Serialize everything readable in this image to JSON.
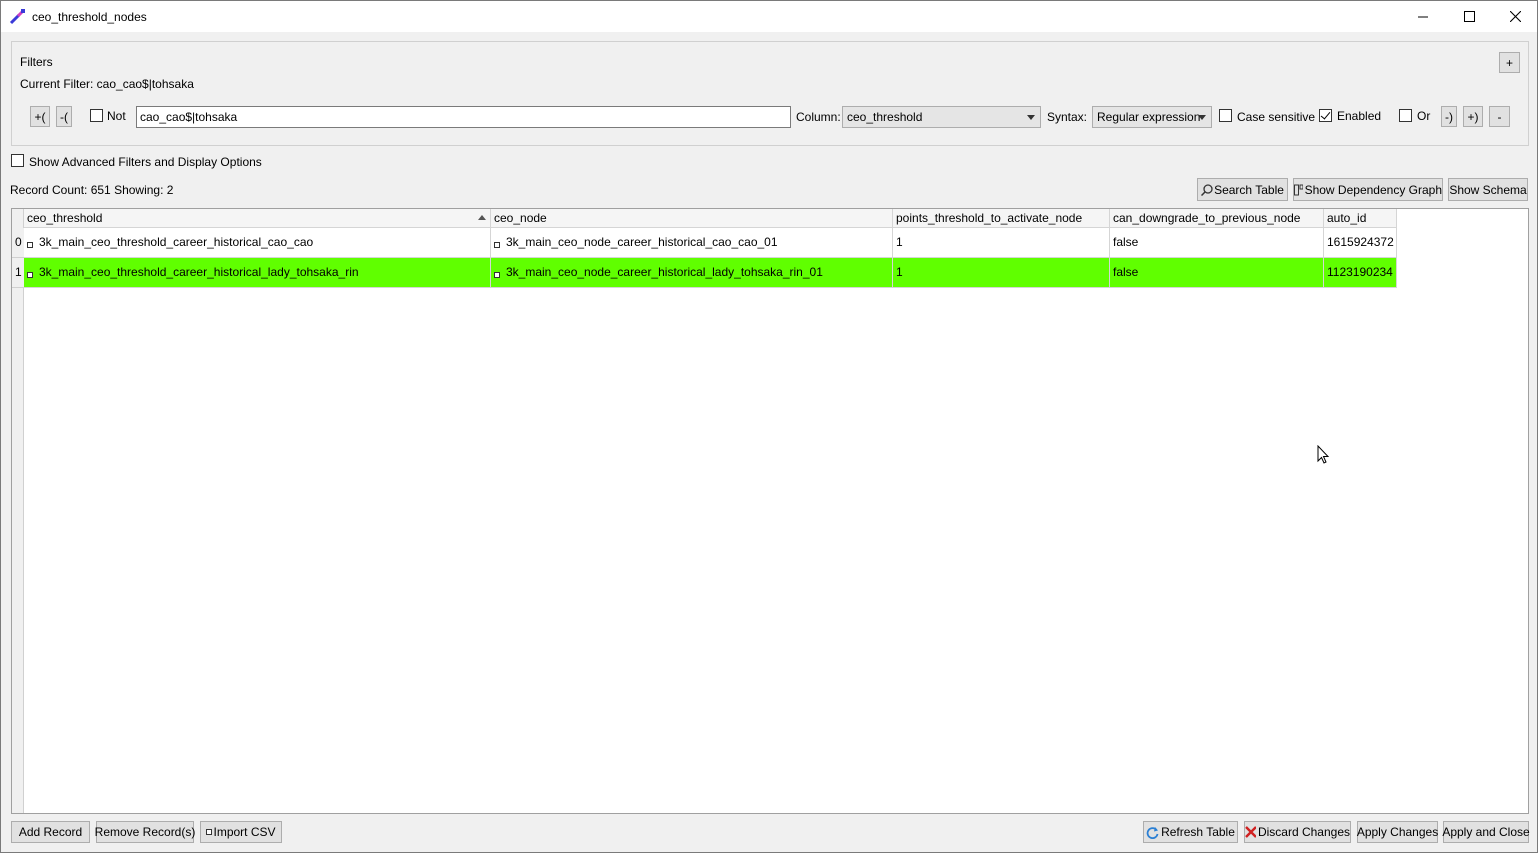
{
  "window": {
    "title": "ceo_threshold_nodes",
    "accent_icon_colors": [
      "#3a3ad8",
      "#d040c0"
    ]
  },
  "filters": {
    "group_label": "Filters",
    "add_label": "+",
    "current_filter_text": "Current Filter: cao_cao$|tohsaka",
    "open_paren_label": "+(",
    "remove_paren_label": "-(",
    "not_label": "Not",
    "not_checked": false,
    "filter_value": "cao_cao$|tohsaka",
    "column_label": "Column:",
    "column_value": "ceo_threshold",
    "syntax_label": "Syntax:",
    "syntax_value": "Regular expression",
    "case_sensitive_label": "Case sensitive",
    "case_sensitive_checked": false,
    "enabled_label": "Enabled",
    "enabled_checked": true,
    "or_label": "Or",
    "or_checked": false,
    "close_paren_minus_label": "-)",
    "close_paren_plus_label": "+)",
    "remove_label": "-"
  },
  "advanced": {
    "label": "Show Advanced Filters and Display Options",
    "checked": false
  },
  "status": {
    "record_count_text": "Record Count:  651  Showing:  2"
  },
  "toolbar": {
    "search_table": "Search Table",
    "show_dependency_graph": "Show Dependency Graph",
    "show_schema": "Show Schema"
  },
  "table": {
    "columns": [
      "ceo_threshold",
      "ceo_node",
      "points_threshold_to_activate_node",
      "can_downgrade_to_previous_node",
      "auto_id"
    ],
    "sorted_column": "ceo_threshold",
    "rows": [
      {
        "index": "0",
        "ceo_threshold": "3k_main_ceo_threshold_career_historical_cao_cao",
        "ceo_node": "3k_main_ceo_node_career_historical_cao_cao_01",
        "points": "1",
        "can_downgrade": "false",
        "auto_id": "1615924372",
        "highlight": false
      },
      {
        "index": "1",
        "ceo_threshold": "3k_main_ceo_threshold_career_historical_lady_tohsaka_rin",
        "ceo_node": "3k_main_ceo_node_career_historical_lady_tohsaka_rin_01",
        "points": "1",
        "can_downgrade": "false",
        "auto_id": "1123190234",
        "highlight": true
      }
    ],
    "highlight_color": "#60ff00"
  },
  "footer": {
    "add_record": "Add Record",
    "remove_records": "Remove Record(s)",
    "import_csv": "Import CSV",
    "refresh_table": "Refresh Table",
    "discard_changes": "Discard Changes",
    "apply_changes": "Apply Changes",
    "apply_and_close": "Apply and Close"
  }
}
